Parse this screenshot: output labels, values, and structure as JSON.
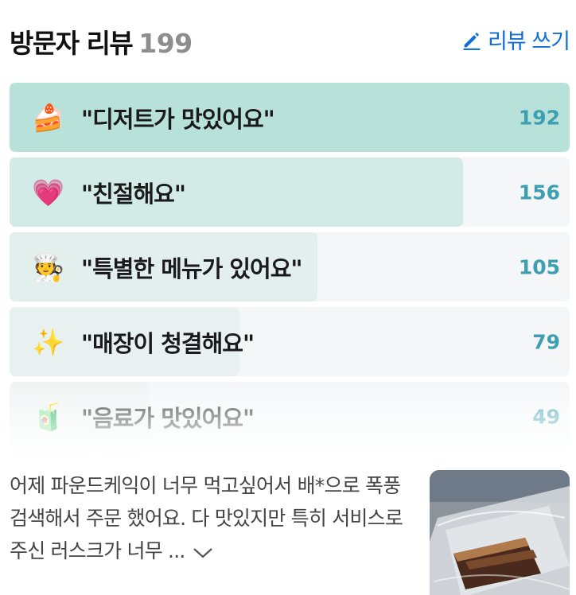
{
  "header": {
    "title": "방문자 리뷰",
    "count": "199",
    "write_label": "리뷰 쓰기"
  },
  "colors": {
    "accent": "#0f6fd6",
    "count": "#3d9fb0",
    "track": "#f4f6f7"
  },
  "keywords": [
    {
      "icon": "cake-icon",
      "emoji": "🍰",
      "label": "\"디저트가 맛있어요\"",
      "count": "192",
      "level": 1.0,
      "fill": "#b8e1d9"
    },
    {
      "icon": "heart-icon",
      "emoji": "💗",
      "label": "\"친절해요\"",
      "count": "156",
      "level": 0.81,
      "fill": "#d3ebe7"
    },
    {
      "icon": "chef-icon",
      "emoji": "🧑‍🍳",
      "label": "\"특별한 메뉴가 있어요\"",
      "count": "105",
      "level": 0.55,
      "fill": "#e2efed"
    },
    {
      "icon": "sparkles-icon",
      "emoji": "✨",
      "label": "\"매장이 청결해요\"",
      "count": "79",
      "level": 0.41,
      "fill": "#e8f1f0"
    },
    {
      "icon": "drink-icon",
      "emoji": "🧃",
      "label": "\"음료가 맛있어요\"",
      "count": "49",
      "level": 0.25,
      "fill": "#edf3f2"
    }
  ],
  "review": {
    "text": "어제 파운드케익이 너무 먹고싶어서 배*으로 폭풍검색해서 주문 했어요. 다 맛있지만 특히 서비스로 주신 러스크가 너무 ..."
  }
}
